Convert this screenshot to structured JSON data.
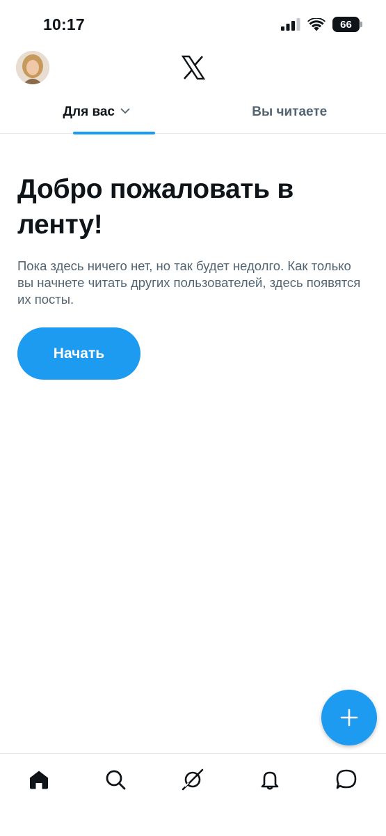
{
  "status_bar": {
    "time": "10:17",
    "battery_level": "66",
    "icons": [
      "signal-icon",
      "wifi-icon",
      "battery-icon"
    ]
  },
  "header": {
    "logo_icon": "x-logo-icon",
    "avatar_icon": "avatar"
  },
  "tabs": [
    {
      "label": "Для вас",
      "active": true,
      "icon": "chevron-down-icon"
    },
    {
      "label": "Вы читаете",
      "active": false
    }
  ],
  "main": {
    "title": "Добро пожаловать в ленту!",
    "subtitle": "Пока здесь ничего нет, но так будет недолго. Как только вы начнете читать других пользователей, здесь появятся их посты.",
    "start_button": "Начать"
  },
  "fab": {
    "icon": "plus-icon"
  },
  "bottom_nav": {
    "items": [
      {
        "icon": "home-icon",
        "active": true
      },
      {
        "icon": "search-icon",
        "active": false
      },
      {
        "icon": "grok-icon",
        "active": false
      },
      {
        "icon": "bell-icon",
        "active": false
      },
      {
        "icon": "messages-icon",
        "active": false
      }
    ]
  },
  "colors": {
    "accent": "#1d9bf0",
    "text_primary": "#0f1419",
    "text_secondary": "#536471",
    "divider": "#e6e9eb"
  }
}
